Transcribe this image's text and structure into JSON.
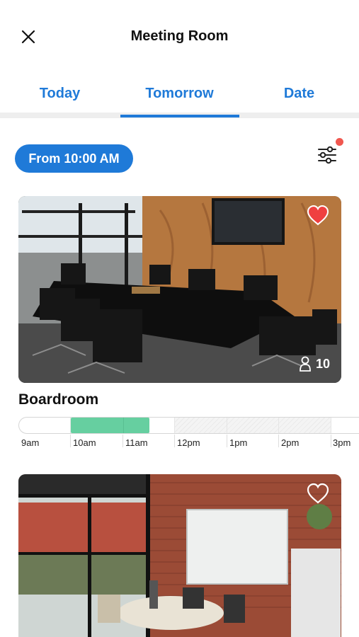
{
  "header": {
    "title": "Meeting Room",
    "close_icon": "close-icon"
  },
  "tabs": [
    {
      "label": "Today",
      "selected": false
    },
    {
      "label": "Tomorrow",
      "selected": true
    },
    {
      "label": "Date",
      "selected": false
    }
  ],
  "colors": {
    "accent": "#1f7ad8",
    "booked": "#66cfa0",
    "favorite": "#ef4040",
    "badge": "#f0574f"
  },
  "filter": {
    "time_label": "From 10:00 AM",
    "filter_icon": "sliders-icon",
    "has_notification": true
  },
  "rooms": [
    {
      "name": "Boardroom",
      "capacity": "10",
      "favorite": true,
      "timeline": {
        "hours": [
          "9am",
          "10am",
          "11am",
          "12pm",
          "1pm",
          "2pm",
          "3pm"
        ],
        "booked": [
          "10am",
          "11am"
        ],
        "unavailable": [
          "12pm",
          "1pm",
          "2pm"
        ]
      }
    },
    {
      "favorite": false
    }
  ]
}
